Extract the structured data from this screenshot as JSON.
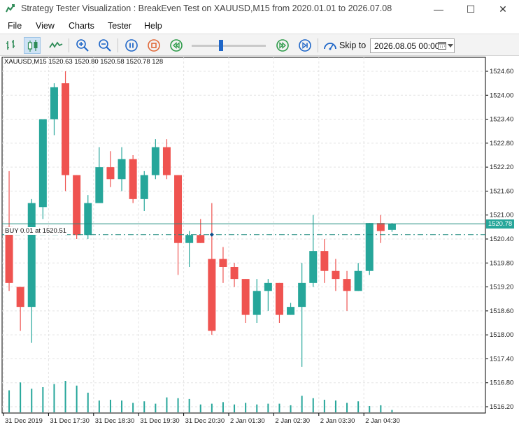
{
  "window": {
    "title": "Strategy Tester Visualization : BreakEven Test on XAUUSD,M15 from 2020.01.01 to 2026.07.08",
    "minimize_glyph": "—",
    "maximize_glyph": "☐",
    "close_glyph": "✕"
  },
  "menu": {
    "items": [
      "File",
      "View",
      "Charts",
      "Tester",
      "Help"
    ]
  },
  "toolbar": {
    "buttons": [
      "bar-chart-icon",
      "candlestick-icon",
      "line-chart-icon",
      "zoom-in-icon",
      "zoom-out-icon",
      "pause-icon",
      "stop-icon",
      "rewind-icon",
      "fast-forward-icon",
      "skip-end-icon"
    ],
    "speed_slider": 0.4,
    "skip_label": "Skip to",
    "skip_value": "2026.08.05 00:00"
  },
  "colors": {
    "bull": "#26a69a",
    "bear": "#ef5350",
    "grid": "#e3e3e3",
    "axis_text": "#222222",
    "accent": "#1e66c8"
  },
  "chart": {
    "info": "XAUUSD,M15  1520.63  1520.80  1520.58  1520.78  128",
    "buy_label": "BUY 0.01 at 1520.51",
    "current_price": "1520.78",
    "buy_price": 1520.51
  },
  "chart_data": {
    "type": "candlestick",
    "symbol": "XAUUSD",
    "timeframe": "M15",
    "ylim": [
      1515.8,
      1524.8
    ],
    "y_ticks": [
      "1524.60",
      "1524.00",
      "1523.40",
      "1522.80",
      "1522.20",
      "1521.60",
      "1521.00",
      "1520.40",
      "1519.80",
      "1519.20",
      "1518.60",
      "1518.00",
      "1517.40",
      "1516.80",
      "1516.20"
    ],
    "x_labels": [
      "31 Dec 2019",
      "31 Dec 17:30",
      "31 Dec 18:30",
      "31 Dec 19:30",
      "31 Dec 20:30",
      "2 Jan 01:30",
      "2 Jan 02:30",
      "2 Jan 03:30",
      "2 Jan 04:30"
    ],
    "candles": [
      {
        "o": 1520.7,
        "h": 1522.1,
        "l": 1519.1,
        "c": 1519.3
      },
      {
        "o": 1519.2,
        "h": 1518.8,
        "l": 1518.1,
        "c": 1518.7
      },
      {
        "o": 1518.7,
        "h": 1521.4,
        "l": 1517.8,
        "c": 1521.3
      },
      {
        "o": 1521.2,
        "h": 1523.4,
        "l": 1520.9,
        "c": 1523.4
      },
      {
        "o": 1523.4,
        "h": 1524.3,
        "l": 1523.0,
        "c": 1524.2
      },
      {
        "o": 1524.3,
        "h": 1524.6,
        "l": 1521.6,
        "c": 1522.0
      },
      {
        "o": 1522.0,
        "h": 1522.0,
        "l": 1520.4,
        "c": 1520.5
      },
      {
        "o": 1520.5,
        "h": 1521.5,
        "l": 1520.4,
        "c": 1521.3
      },
      {
        "o": 1521.3,
        "h": 1522.7,
        "l": 1521.3,
        "c": 1522.2
      },
      {
        "o": 1522.2,
        "h": 1522.6,
        "l": 1521.7,
        "c": 1521.9
      },
      {
        "o": 1521.9,
        "h": 1522.7,
        "l": 1521.6,
        "c": 1522.4
      },
      {
        "o": 1522.4,
        "h": 1522.5,
        "l": 1521.3,
        "c": 1521.4
      },
      {
        "o": 1521.4,
        "h": 1522.1,
        "l": 1521.1,
        "c": 1522.0
      },
      {
        "o": 1522.0,
        "h": 1522.9,
        "l": 1521.9,
        "c": 1522.7
      },
      {
        "o": 1522.7,
        "h": 1522.9,
        "l": 1521.9,
        "c": 1522.0
      },
      {
        "o": 1522.0,
        "h": 1522.0,
        "l": 1519.5,
        "c": 1520.3
      },
      {
        "o": 1520.3,
        "h": 1520.6,
        "l": 1519.7,
        "c": 1520.5
      },
      {
        "o": 1520.5,
        "h": 1520.9,
        "l": 1520.4,
        "c": 1520.3
      },
      {
        "o": 1519.9,
        "h": 1521.3,
        "l": 1518.0,
        "c": 1518.1
      },
      {
        "o": 1519.9,
        "h": 1520.2,
        "l": 1519.3,
        "c": 1519.7
      },
      {
        "o": 1519.7,
        "h": 1519.8,
        "l": 1519.2,
        "c": 1519.4
      },
      {
        "o": 1519.4,
        "h": 1519.4,
        "l": 1518.3,
        "c": 1518.5
      },
      {
        "o": 1518.5,
        "h": 1519.4,
        "l": 1518.3,
        "c": 1519.1
      },
      {
        "o": 1519.1,
        "h": 1519.4,
        "l": 1518.6,
        "c": 1519.3
      },
      {
        "o": 1519.3,
        "h": 1519.3,
        "l": 1518.3,
        "c": 1518.5
      },
      {
        "o": 1518.5,
        "h": 1518.8,
        "l": 1518.5,
        "c": 1518.7
      },
      {
        "o": 1518.7,
        "h": 1519.8,
        "l": 1517.2,
        "c": 1519.3
      },
      {
        "o": 1519.3,
        "h": 1521.0,
        "l": 1519.2,
        "c": 1520.1
      },
      {
        "o": 1520.1,
        "h": 1520.4,
        "l": 1519.3,
        "c": 1519.6
      },
      {
        "o": 1519.6,
        "h": 1519.9,
        "l": 1519.1,
        "c": 1519.4
      },
      {
        "o": 1519.4,
        "h": 1519.6,
        "l": 1518.6,
        "c": 1519.1
      },
      {
        "o": 1519.1,
        "h": 1519.8,
        "l": 1519.1,
        "c": 1519.6
      },
      {
        "o": 1519.6,
        "h": 1520.8,
        "l": 1519.5,
        "c": 1520.8
      },
      {
        "o": 1520.8,
        "h": 1521.0,
        "l": 1520.3,
        "c": 1520.6
      },
      {
        "o": 1520.63,
        "h": 1520.8,
        "l": 1520.58,
        "c": 1520.78
      }
    ],
    "volumes": [
      28,
      38,
      30,
      32,
      36,
      40,
      34,
      25,
      15,
      16,
      15,
      12,
      14,
      11,
      19,
      18,
      17,
      10,
      11,
      13,
      10,
      12,
      10,
      11,
      11,
      9,
      21,
      18,
      16,
      15,
      12,
      14,
      8,
      9,
      3
    ]
  }
}
